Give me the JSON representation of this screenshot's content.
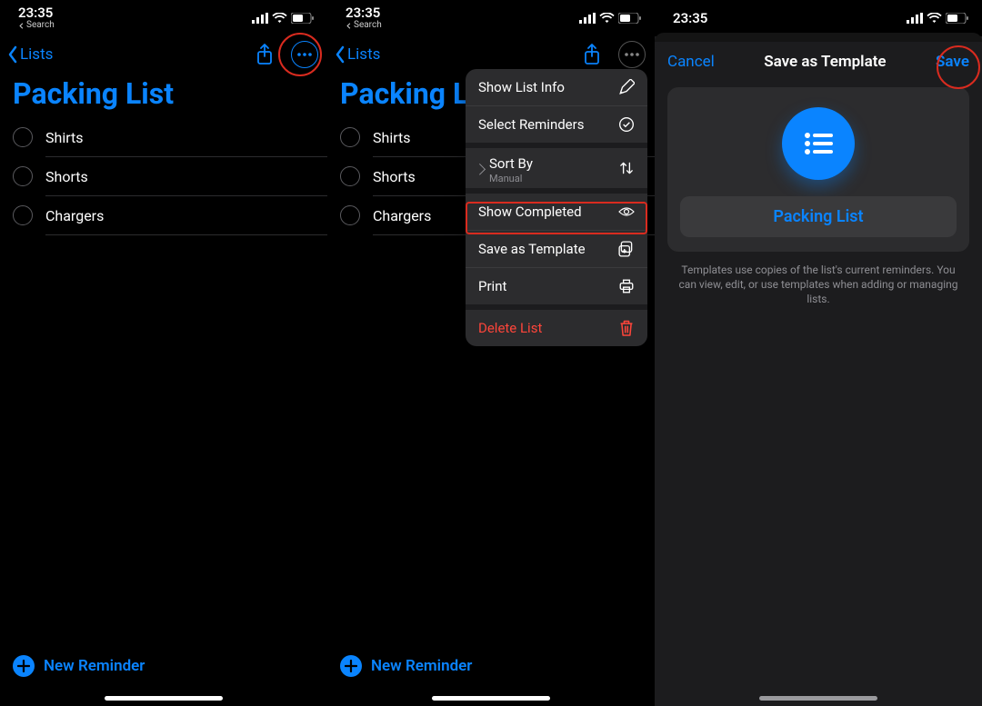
{
  "status": {
    "time": "23:35",
    "back_search": "Search"
  },
  "nav": {
    "back_label": "Lists"
  },
  "list": {
    "title": "Packing List",
    "items": [
      "Shirts",
      "Shorts",
      "Chargers"
    ]
  },
  "footer": {
    "new_reminder": "New Reminder"
  },
  "context_menu": {
    "show_info": "Show List Info",
    "select": "Select Reminders",
    "sort_by": "Sort By",
    "sort_by_value": "Manual",
    "show_completed": "Show Completed",
    "save_template": "Save as Template",
    "print": "Print",
    "delete": "Delete List"
  },
  "modal": {
    "cancel": "Cancel",
    "title": "Save as Template",
    "save": "Save",
    "template_name": "Packing List",
    "description": "Templates use copies of the list's current reminders. You can view, edit, or use templates when adding or managing lists."
  }
}
